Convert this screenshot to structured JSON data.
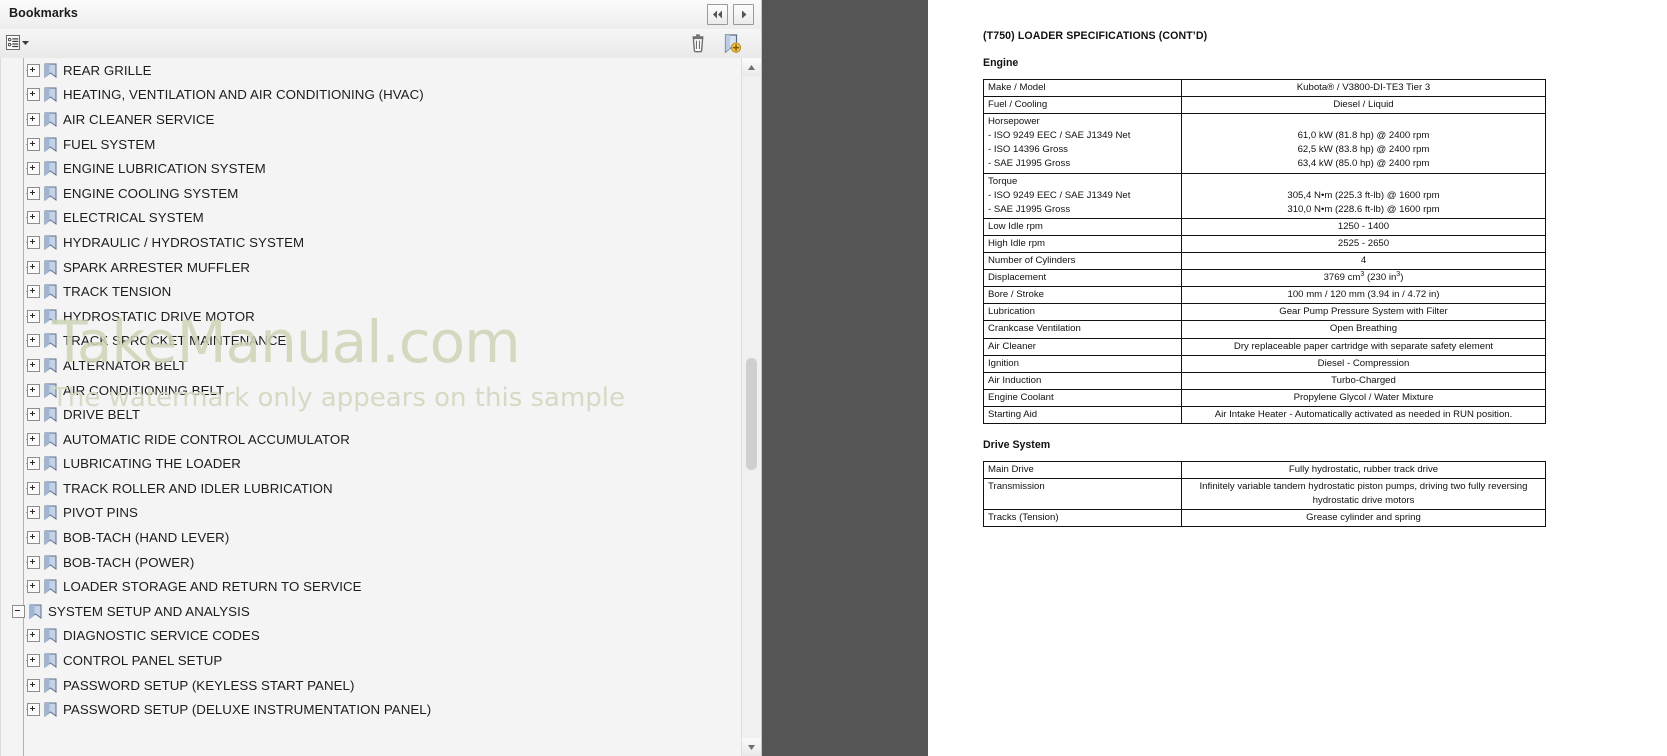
{
  "bookmarks_panel": {
    "title": "Bookmarks",
    "nav": {
      "prev_label": "◀◀",
      "next_label": "▶"
    },
    "toolbar": {
      "options_label": "options-menu",
      "delete_label": "delete-bookmark",
      "new_bookmark_label": "new-bookmark"
    },
    "items": [
      {
        "label": "REAR GRILLE",
        "level": 2,
        "state": "collapsed"
      },
      {
        "label": "HEATING, VENTILATION AND AIR CONDITIONING (HVAC)",
        "level": 2,
        "state": "collapsed"
      },
      {
        "label": "AIR CLEANER SERVICE",
        "level": 2,
        "state": "collapsed"
      },
      {
        "label": "FUEL SYSTEM",
        "level": 2,
        "state": "collapsed"
      },
      {
        "label": "ENGINE LUBRICATION SYSTEM",
        "level": 2,
        "state": "collapsed"
      },
      {
        "label": "ENGINE COOLING SYSTEM",
        "level": 2,
        "state": "collapsed"
      },
      {
        "label": "ELECTRICAL SYSTEM",
        "level": 2,
        "state": "collapsed"
      },
      {
        "label": "HYDRAULIC / HYDROSTATIC SYSTEM",
        "level": 2,
        "state": "collapsed"
      },
      {
        "label": "SPARK ARRESTER MUFFLER",
        "level": 2,
        "state": "collapsed"
      },
      {
        "label": "TRACK TENSION",
        "level": 2,
        "state": "collapsed"
      },
      {
        "label": "HYDROSTATIC DRIVE MOTOR",
        "level": 2,
        "state": "collapsed"
      },
      {
        "label": "TRACK SPROCKET MAINTENANCE",
        "level": 2,
        "state": "collapsed"
      },
      {
        "label": "ALTERNATOR BELT",
        "level": 2,
        "state": "collapsed"
      },
      {
        "label": "AIR CONDITIONING BELT",
        "level": 2,
        "state": "collapsed"
      },
      {
        "label": "DRIVE BELT",
        "level": 2,
        "state": "collapsed"
      },
      {
        "label": "AUTOMATIC RIDE CONTROL ACCUMULATOR",
        "level": 2,
        "state": "collapsed"
      },
      {
        "label": "LUBRICATING THE LOADER",
        "level": 2,
        "state": "collapsed"
      },
      {
        "label": "TRACK ROLLER AND IDLER LUBRICATION",
        "level": 2,
        "state": "collapsed"
      },
      {
        "label": "PIVOT PINS",
        "level": 2,
        "state": "collapsed"
      },
      {
        "label": "BOB-TACH (HAND LEVER)",
        "level": 2,
        "state": "collapsed"
      },
      {
        "label": "BOB-TACH (POWER)",
        "level": 2,
        "state": "collapsed"
      },
      {
        "label": "LOADER STORAGE AND RETURN TO SERVICE",
        "level": 2,
        "state": "collapsed"
      },
      {
        "label": "SYSTEM SETUP AND ANALYSIS",
        "level": 1,
        "state": "expanded"
      },
      {
        "label": "DIAGNOSTIC SERVICE CODES",
        "level": 2,
        "state": "collapsed"
      },
      {
        "label": "CONTROL PANEL SETUP",
        "level": 2,
        "state": "collapsed"
      },
      {
        "label": "PASSWORD SETUP (KEYLESS START PANEL)",
        "level": 2,
        "state": "collapsed"
      },
      {
        "label": "PASSWORD SETUP (DELUXE INSTRUMENTATION PANEL)",
        "level": 2,
        "state": "collapsed"
      }
    ],
    "watermark": {
      "main": "TakeManual.com",
      "sub": "The watermark only appears on this sample"
    }
  },
  "document": {
    "heading": "(T750) LOADER SPECIFICATIONS (CONT’D)",
    "sections": [
      {
        "title": "Engine",
        "rows": [
          {
            "key": "Make / Model",
            "value": "Kubota® / V3800-DI-TE3 Tier 3"
          },
          {
            "key": "Fuel / Cooling",
            "value": "Diesel / Liquid"
          },
          {
            "key": "Horsepower",
            "key_sublines": [
              "- ISO 9249 EEC / SAE J1349 Net",
              "- ISO 14396 Gross",
              "- SAE J1995 Gross"
            ],
            "value_sublines": [
              "61,0 kW (81.8 hp) @ 2400 rpm",
              "62,5 kW (83.8 hp) @ 2400 rpm",
              "63,4 kW (85.0 hp) @ 2400 rpm"
            ]
          },
          {
            "key": "Torque",
            "key_sublines": [
              "- ISO 9249 EEC / SAE J1349 Net",
              "- SAE J1995 Gross"
            ],
            "value_sublines": [
              "305,4 N•m (225.3 ft-lb) @ 1600 rpm",
              "310,0 N•m (228.6 ft-lb) @ 1600 rpm"
            ]
          },
          {
            "key": "Low Idle rpm",
            "value": "1250 - 1400"
          },
          {
            "key": "High Idle rpm",
            "value": "2525 - 2650"
          },
          {
            "key": "Number of Cylinders",
            "value": "4"
          },
          {
            "key": "Displacement",
            "value_html": "3769 cm<sup class=\"sub\">3</sup> (230 in<sup class=\"sub\">3</sup>)"
          },
          {
            "key": "Bore / Stroke",
            "value": "100 mm / 120 mm (3.94 in / 4.72 in)"
          },
          {
            "key": "Lubrication",
            "value": "Gear Pump Pressure System with Filter"
          },
          {
            "key": "Crankcase Ventilation",
            "value": "Open Breathing"
          },
          {
            "key": "Air Cleaner",
            "value": "Dry replaceable paper cartridge with separate safety element"
          },
          {
            "key": "Ignition",
            "value": "Diesel - Compression"
          },
          {
            "key": "Air Induction",
            "value": "Turbo-Charged"
          },
          {
            "key": "Engine Coolant",
            "value": "Propylene Glycol / Water Mixture"
          },
          {
            "key": "Starting Aid",
            "value": "Air Intake Heater - Automatically activated as needed in RUN position."
          }
        ]
      },
      {
        "title": "Drive System",
        "rows": [
          {
            "key": "Main Drive",
            "value": "Fully hydrostatic, rubber track drive"
          },
          {
            "key": "Transmission",
            "value": "Infinitely variable tandem hydrostatic piston pumps, driving two fully reversing hydrostatic drive motors"
          },
          {
            "key": "Tracks (Tension)",
            "value": "Grease cylinder and spring"
          }
        ]
      }
    ]
  },
  "colors": {
    "panel_bg": "#f2f2f2",
    "gutter": "#555555",
    "page": "#ffffff",
    "watermark": "#cdd5b6",
    "ribbon": "#aebdd4"
  }
}
